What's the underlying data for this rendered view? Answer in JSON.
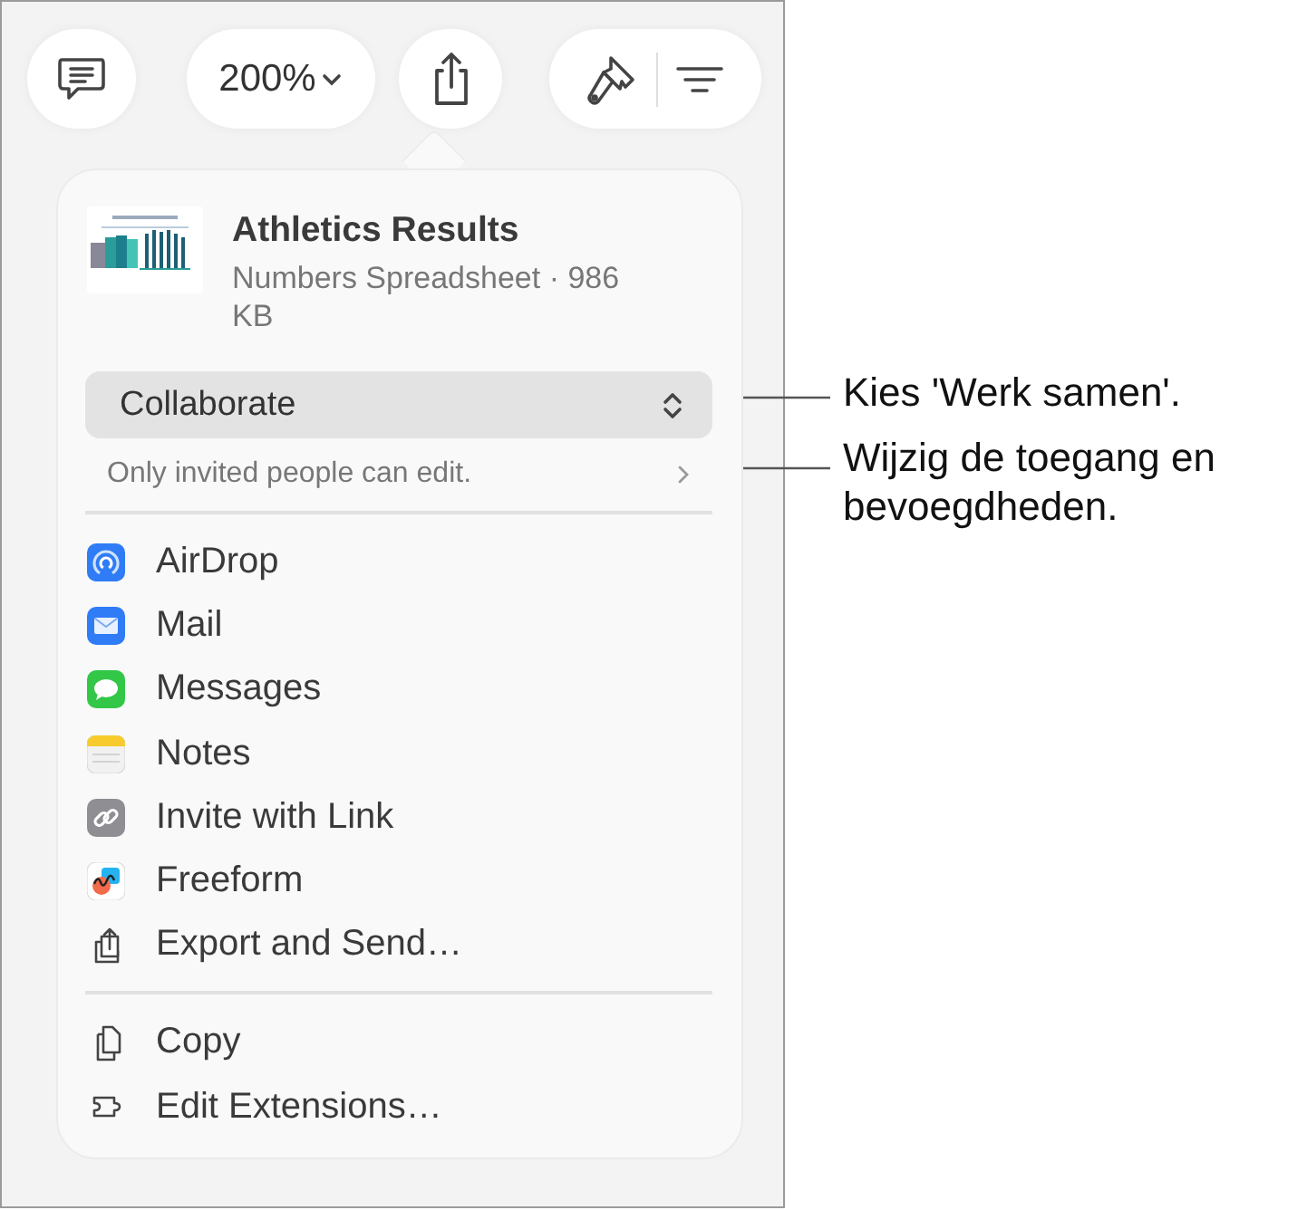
{
  "toolbar": {
    "zoom": "200%"
  },
  "document": {
    "title": "Athletics Results",
    "subtitle": "Numbers Spreadsheet · 986 KB"
  },
  "collaboration": {
    "mode": "Collaborate",
    "access": "Only invited people can edit."
  },
  "menu_sections": [
    [
      {
        "label": "AirDrop",
        "kind": "app"
      },
      {
        "label": "Mail",
        "kind": "app"
      },
      {
        "label": "Messages",
        "kind": "app"
      },
      {
        "label": "Notes",
        "kind": "app"
      },
      {
        "label": "Invite with Link",
        "kind": "app"
      },
      {
        "label": "Freeform",
        "kind": "app"
      },
      {
        "label": "Export and Send…",
        "kind": "action"
      }
    ],
    [
      {
        "label": "Copy",
        "kind": "action"
      },
      {
        "label": "Edit Extensions…",
        "kind": "action"
      }
    ]
  ],
  "callouts": [
    "Kies 'Werk samen'.",
    "Wijzig de toegang en bevoegdheden."
  ]
}
